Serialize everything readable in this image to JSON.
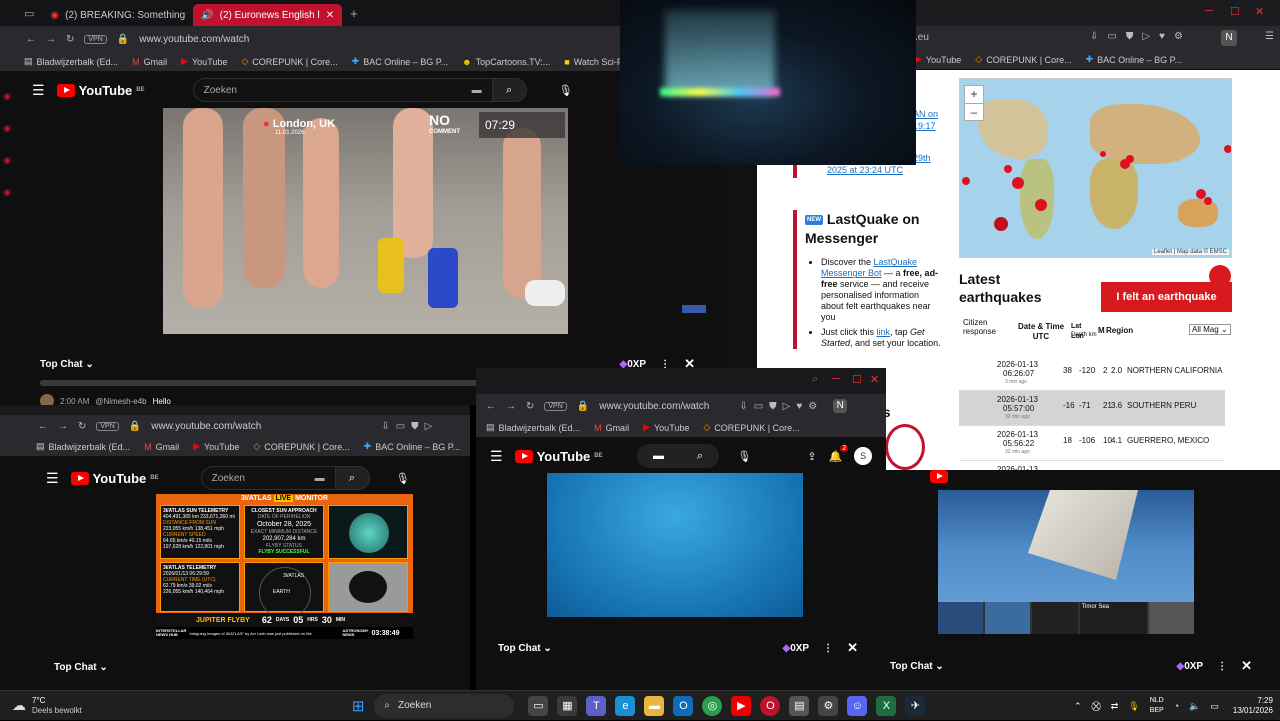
{
  "colors": {
    "brand_red": "#c0122c",
    "yt_red": "#ff0000",
    "emsc_red": "#d71920"
  },
  "win1": {
    "tabs": [
      "(2) BREAKING: Something",
      "(2) Euronews English l"
    ],
    "url": "www.youtube.com/watch",
    "bookmarks": [
      "Bladwijzerbalk (Ed...",
      "Gmail",
      "YouTube",
      "COREPUNK | Core...",
      "BAC Online – BG P...",
      "TopCartoons.TV:...",
      "Watch Sci-Fi Cart"
    ],
    "search_placeholder": "Zoeken",
    "youtube_label": "YouTube",
    "region": "BE",
    "video": {
      "location": "London, UK",
      "date": "11.01.2026",
      "brand": "NO",
      "brand2": "COMMENT",
      "time": "07:29"
    },
    "chat": {
      "label": "Top Chat",
      "xp": "0XP",
      "msg_time": "2:00 AM",
      "msg_user": "@Nimesh-e4b",
      "msg_text": "Hello"
    }
  },
  "win2": {
    "url_suffix": ".eu",
    "bookmarks": [
      "YouTube",
      "COREPUNK | Core...",
      "BAC Online – BG P..."
    ],
    "profile": "N",
    "map_zoom_in": "+",
    "map_zoom_out": "–",
    "map_attribution": "Leaflet | Map data © EMSC",
    "left_text": {
      "l1": "AN on",
      "l2": "19:17",
      "l3": "29th",
      "l4": "2025 at 23:24 UTC"
    },
    "messenger": {
      "badge": "NEW",
      "title": "LastQuake on Messenger",
      "b1a": "Discover the ",
      "b1link": "LastQuake Messenger Bot",
      "b1b": " — a ",
      "b1bold": "free, ad-free",
      "b1c": " service — and receive personalised information about felt earthquakes near you",
      "b2a": "Just click this ",
      "b2link": "link",
      "b2b": ", tap ",
      "b2it": "Get Started",
      "b2c": ", and set your location."
    },
    "latest_title": "Latest earthquakes",
    "felt_button": "I felt an earthquake",
    "cols": {
      "citizen": "Citizen response",
      "datetime": "Date & Time UTC",
      "latlon": "Lat Lon",
      "depth": "Depth km",
      "mag": "M",
      "region": "Region",
      "filter": "All Mag"
    },
    "rows": [
      {
        "date": "2026-01-13",
        "time": "06:26:07",
        "ago": "3 min ago",
        "lat": "38",
        "lon": "-120",
        "depth": "2",
        "mag": "2.0",
        "region": "NORTHERN CALIFORNIA"
      },
      {
        "date": "2026-01-13",
        "time": "05:57:00",
        "ago": "32 min ago",
        "lat": "-16",
        "lon": "-71",
        "depth": "21",
        "mag": "3.6",
        "region": "SOUTHERN PERU"
      },
      {
        "date": "2026-01-13",
        "time": "05:56:22",
        "ago": "32 min ago",
        "lat": "18",
        "lon": "-106",
        "depth": "10",
        "mag": "4.1",
        "region": "GUERRERO, MEXICO"
      },
      {
        "date": "2026-01-13",
        "time": "",
        "ago": "",
        "lat": "",
        "lon": "",
        "depth": "",
        "mag": "",
        "region": ""
      }
    ],
    "partial": "ss"
  },
  "win3": {
    "url": "www.youtube.com/watch",
    "bookmarks": [
      "Bladwijzerbalk (Ed...",
      "Gmail",
      "YouTube",
      "COREPUNK | Core...",
      "BAC Online – BG P..."
    ],
    "search_placeholder": "Zoeken",
    "youtube_label": "YouTube",
    "region": "BE",
    "monitor": {
      "title_a": "3I/ATLAS",
      "title_b": "LIVE",
      "title_c": "MONITOR",
      "panel1": "3I/ATLAS SUN TELEMETRY",
      "p1v1": "404,491,365 km",
      "p1v2": "233,671,360 mi",
      "p1l1": "DISTANCE FROM SUN",
      "p1v3": "223,055 km/h",
      "p1v4": "138,451 mph",
      "p1l2": "CURRENT SPEED",
      "p1v5": "64.65 km/s",
      "p1v6": "40.15 mi/s",
      "p1v7": "197,628 km/h",
      "p1v8": "122,801 mph",
      "panel2": "CLOSEST SUN APPROACH",
      "p2l1": "DATE OF PERIHELION",
      "p2date": "October 28, 2025",
      "p2l2": "EXACT MINIMUM DISTANCE",
      "p2dist": "202,907,284 km",
      "p2l3": "FLYBY STATUS",
      "p2status": "FLYBY SUCCESSFUL",
      "panel4": "3I/ATLAS TELEMETRY",
      "p4date": "2026/01/13 06:29:59",
      "p4l": "CURRENT TIME (UTC)",
      "p4v1": "62.79 km/s",
      "p4v2": "39.02 mi/s",
      "p4v3": "226,055 km/h",
      "p4v4": "140,464 mph",
      "earth": "EARTH",
      "atlas": "3I/ATLAS",
      "jupiter": "JUPITER FLYBY",
      "days": "62",
      "days_l": "DAYS",
      "hrs": "05",
      "hrs_l": "HRS",
      "min": "30",
      "min_l": "MIN",
      "left_brand": "INTERSTELLAR",
      "left_brand2": "NEWS HUB",
      "ticker": "Intriguing Images of 3I/ATLAS\" by Avi Loeb was just published on Me",
      "right_brand": "ASTRONOMY",
      "right_brand2": "NEWS",
      "clock": "03:38:49"
    },
    "chat": {
      "label": "Top Chat"
    }
  },
  "win4": {
    "url": "www.youtube.com/watch",
    "bookmarks": [
      "Bladwijzerbalk (Ed...",
      "Gmail",
      "YouTube",
      "COREPUNK | Core..."
    ],
    "profile": "N",
    "avatar": "S",
    "notif_count": "2",
    "youtube_label": "YouTube",
    "region": "BE",
    "chat": {
      "label": "Top Chat",
      "xp": "0XP"
    }
  },
  "win5": {
    "thumb_label": "Timor Sea",
    "chat": {
      "label": "Top Chat",
      "xp": "0XP"
    }
  },
  "taskbar": {
    "weather_temp": "7°C",
    "weather_desc": "Deels bewolkt",
    "search": "Zoeken",
    "lang1": "NLD",
    "lang2": "BEP",
    "time": "7:29",
    "date": "13/01/2026"
  }
}
